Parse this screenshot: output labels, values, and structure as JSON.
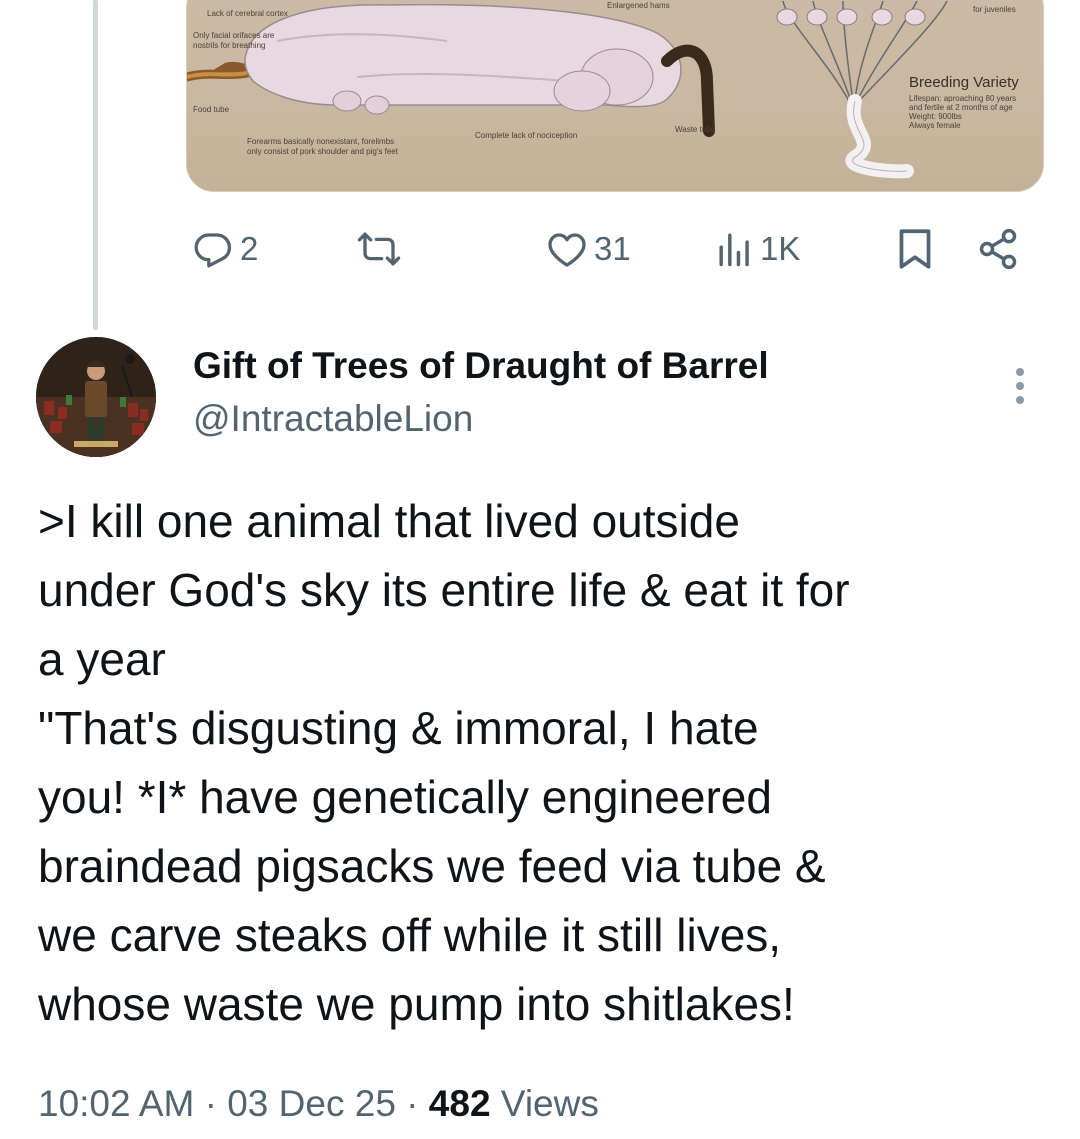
{
  "media": {
    "annotations": {
      "cortex": "Lack of cerebral cortex",
      "orifices_1": "Only facial orifaces are",
      "orifices_2": "nostrils for breathing",
      "food_tube": "Food tube",
      "forearms_1": "Forearms basically nonexistant, forelimbs",
      "forearms_2": "only consist of pork shoulder and pig's feet",
      "nociception": "Complete lack of nociception",
      "hams": "Enlargened hams",
      "waste": "Waste tube",
      "juveniles": "for juveniles",
      "breeding_title": "Breeding Variety",
      "lifespan_1": "Lifespan: aproaching 80 years",
      "lifespan_2": "and fertile at 2 months of age",
      "weight": "Weight: 900lbs",
      "female": "Always female"
    }
  },
  "actions": {
    "reply_count": "2",
    "like_count": "31",
    "views_count": "1K"
  },
  "author": {
    "name": "Gift of Trees of Draught of Barrel",
    "handle": "@IntractableLion"
  },
  "tweet": {
    "text": ">I kill one animal that lived outside\nunder God's sky its entire life & eat it for\na year\n\"That's disgusting & immoral, I hate\nyou! *I* have genetically engineered\nbraindead pigsacks we feed via tube &\nwe carve steaks off while it still lives,\nwhose waste we pump into shitlakes!"
  },
  "meta": {
    "time": "10:02 AM",
    "sep1": " · ",
    "date": "03 Dec 25",
    "sep2": " · ",
    "views_number": "482",
    "views_label": " Views"
  },
  "icons": {
    "reply": "reply-icon",
    "retweet": "retweet-icon",
    "like": "like-icon",
    "views": "views-icon",
    "bookmark": "bookmark-icon",
    "share": "share-icon",
    "more": "more-icon"
  },
  "colors": {
    "text": "#0f1419",
    "muted": "#536471",
    "thread_line": "#cfd9de",
    "card_bg": "#cbbba6"
  }
}
